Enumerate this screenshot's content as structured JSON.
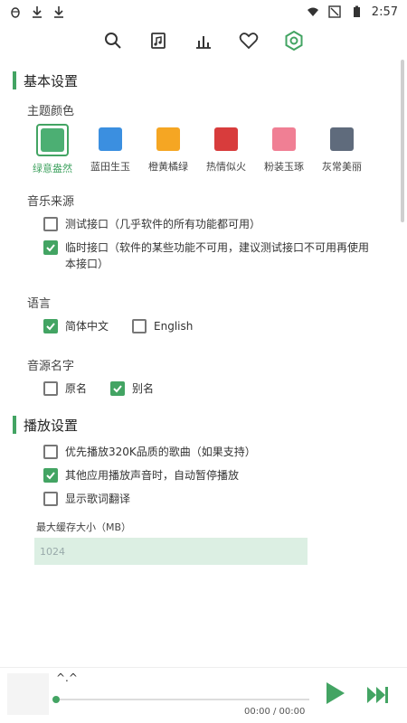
{
  "status_bar": {
    "time": "2:57",
    "left_icons": [
      "bug-icon",
      "download-icon",
      "download-icon"
    ],
    "right_icons": [
      "wifi-icon",
      "signal-off-icon",
      "battery-icon"
    ]
  },
  "toolbar": {
    "icons": [
      "search-icon",
      "music-file-icon",
      "chart-icon",
      "heart-icon",
      "settings-icon"
    ],
    "active": "settings-icon"
  },
  "basic_settings": {
    "title": "基本设置",
    "theme_label": "主题颜色",
    "themes": [
      {
        "label": "绿意盎然",
        "color": "#4caf73",
        "selected": true
      },
      {
        "label": "蓝田生玉",
        "color": "#3b8fe0",
        "selected": false
      },
      {
        "label": "橙黄橘绿",
        "color": "#f5a623",
        "selected": false
      },
      {
        "label": "热情似火",
        "color": "#d83c3c",
        "selected": false
      },
      {
        "label": "粉装玉琢",
        "color": "#f07f94",
        "selected": false
      },
      {
        "label": "灰常美丽",
        "color": "#5f6b7c",
        "selected": false
      }
    ],
    "music_source_label": "音乐来源",
    "music_sources": [
      {
        "label": "测试接口（几乎软件的所有功能都可用）",
        "checked": false
      },
      {
        "label": "临时接口（软件的某些功能不可用，建议测试接口不可用再使用本接口）",
        "checked": true
      }
    ],
    "language_label": "语言",
    "languages": [
      {
        "label": "简体中文",
        "checked": true
      },
      {
        "label": "English",
        "checked": false
      }
    ],
    "source_name_label": "音源名字",
    "source_names": [
      {
        "label": "原名",
        "checked": false
      },
      {
        "label": "别名",
        "checked": true
      }
    ]
  },
  "play_settings": {
    "title": "播放设置",
    "options": [
      {
        "label": "优先播放320K品质的歌曲（如果支持）",
        "checked": false
      },
      {
        "label": "其他应用播放声音时，自动暂停播放",
        "checked": true
      },
      {
        "label": "显示歌词翻译",
        "checked": false
      }
    ],
    "cache_label": "最大缓存大小（MB）",
    "cache_placeholder": "1024"
  },
  "player": {
    "title": "^.^",
    "time": "00:00 / 00:00",
    "progress": 0
  },
  "colors": {
    "accent": "#43a463"
  }
}
